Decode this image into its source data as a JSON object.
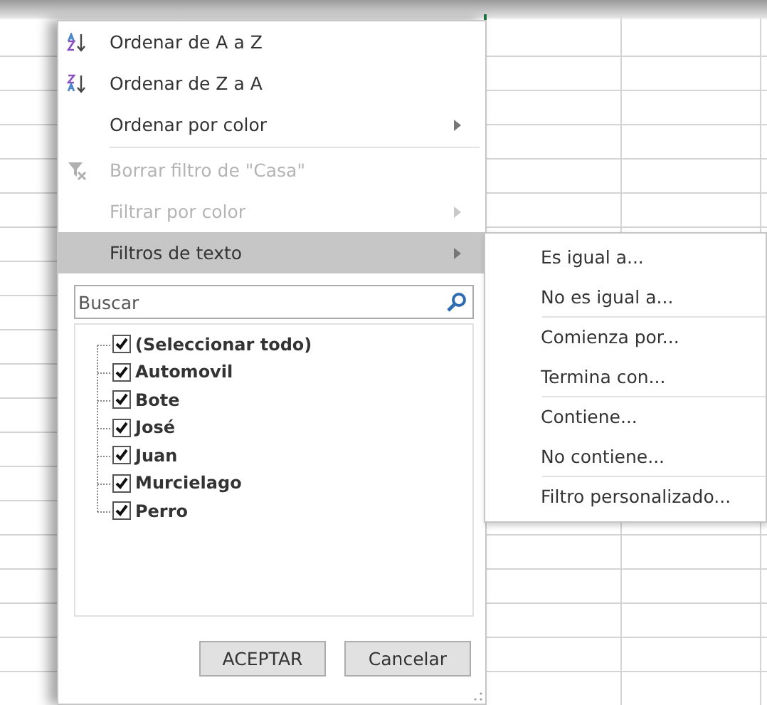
{
  "menu": {
    "groups": [
      [
        {
          "label": "Ordenar de A a Z",
          "kind": "ascending",
          "disabled": false,
          "selected": false,
          "submenu": false
        },
        {
          "label": "Ordenar de Z a A",
          "kind": "descending",
          "disabled": false,
          "selected": false,
          "submenu": false
        },
        {
          "label": "Ordenar por color",
          "kind": "plain",
          "disabled": false,
          "selected": false,
          "submenu": true
        }
      ],
      [
        {
          "label": "Borrar filtro de \"Casa\"",
          "kind": "clearfilter",
          "disabled": true,
          "selected": false,
          "submenu": false
        },
        {
          "label": "Filtrar por color",
          "kind": "plain",
          "disabled": true,
          "selected": false,
          "submenu": true
        },
        {
          "label": "Filtros de texto",
          "kind": "plain",
          "disabled": false,
          "selected": true,
          "submenu": true
        }
      ]
    ],
    "search": {
      "placeholder": "Buscar"
    },
    "values": [
      {
        "label": "(Seleccionar todo)",
        "checked": true
      },
      {
        "label": "Automovil",
        "checked": true
      },
      {
        "label": "Bote",
        "checked": true
      },
      {
        "label": "José",
        "checked": true
      },
      {
        "label": "Juan",
        "checked": true
      },
      {
        "label": "Murcielago",
        "checked": true
      },
      {
        "label": "Perro",
        "checked": true
      }
    ],
    "buttons": [
      "ACEPTAR",
      "Cancelar"
    ]
  },
  "submenu": {
    "groups": [
      [
        "Es igual a...",
        "No es igual a..."
      ],
      [
        "Comienza por...",
        "Termina con..."
      ],
      [
        "Contiene...",
        "No contiene..."
      ],
      [
        "Filtro personalizado..."
      ]
    ]
  }
}
